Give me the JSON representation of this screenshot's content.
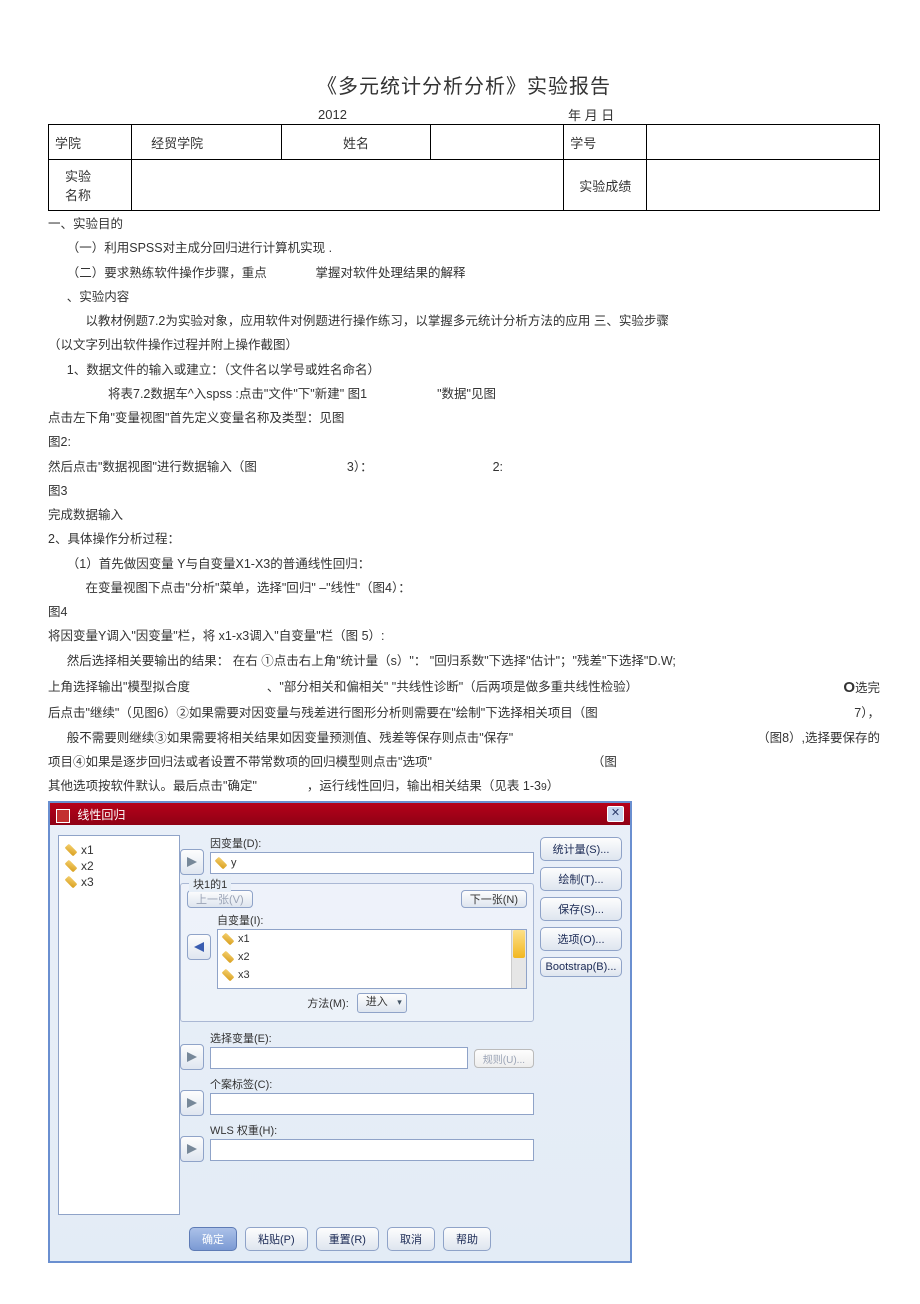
{
  "title": "《多元统计分析分析》实验报告",
  "date": {
    "year": "2012",
    "rest": "年 月 日"
  },
  "header": {
    "college_label": "学院",
    "college_value": "经贸学院",
    "name_label": "姓名",
    "id_label": "学号",
    "exp_name_label_1": "实验",
    "exp_name_label_2": "名称",
    "score_label": "实验成绩"
  },
  "body": {
    "sec1": "一、实验目的",
    "sec1_1": "（一）利用SPSS对主成分回归进行计算机实现 .",
    "sec1_2a": "（二）要求熟练软件操作步骤，重点",
    "sec1_2b": "掌握对软件处理结果的解释",
    "sec2": "、实验内容",
    "sec2_1": "以教材例题7.2为实验对象，应用软件对例题进行操作练习，以掌握多元统计分析方法的应用 三、实验步骤",
    "sec2_2": "（以文字列出软件操作过程并附上操作截图）",
    "step1": "1、数据文件的输入或建立：（文件名以学号或姓名命名）",
    "p1a": "将表7.2数据车^入spss :点击\"文件\"下\"新建\"  图1",
    "p1b": "\"数据\"见图",
    "p2": "点击左下角\"变量视图\"首先定义变量名称及类型：见图",
    "p3": "图2:",
    "p4a": "然后点击\"数据视图\"进行数据输入（图",
    "p4b": "3）：",
    "p4c": "2:",
    "p5": "图3",
    "p6": "完成数据输入",
    "step2": "2、具体操作分析过程：",
    "p7": "（1）首先做因变量 Y与自变量X1-X3的普通线性回归：",
    "p8": "在变量视图下点击\"分析\"菜单，选择\"回归\" –\"线性\"（图4）：",
    "p9": "图4",
    "p10": "将因变量Y调入\"因变量\"栏，将 x1-x3调入\"自变量\"栏（图 5）:",
    "p11a": "然后选择相关要输出的结果：  在右  ①点击右上角\"统计量（s）\"：  \"回归系数\"下选择\"估计\"；\"残差\"下选择\"D.W;",
    "p12a": "上角选择输出\"模型拟合度",
    "p12b": "、\"部分相关和偏相关\" \"共线性诊断\"（后两项是做多重共线性检验）",
    "p12c": "O",
    "p12d": "选完",
    "p13a": "后点击\"继续\"（见图6）②如果需要对因变量与残差进行图形分析则需要在\"绘制\"下选择相关项目（图",
    "p13b": "7），",
    "p14a": "般不需要则继续③如果需要将相关结果如因变量预测值、残差等保存则点击\"保存\"",
    "p14b": "（图8）,选择要保存的",
    "p15a": "项目④如果是逐步回归法或者设置不带常数项的回归模型则点击\"选项\"",
    "p15b": "（图",
    "p16a": "其他选项按软件默认。最后点击\"确定\"",
    "p16b": "，运行线性回归，输出相关结果（见表 1-3",
    "p16c": "9",
    "p16d": "）"
  },
  "dialog": {
    "title": "线性回归",
    "vars": [
      "x1",
      "x2",
      "x3"
    ],
    "dep_label": "因变量(D):",
    "dep_value": "y",
    "block_label": "块1的1",
    "prev_btn": "上一张(V)",
    "next_btn": "下一张(N)",
    "indep_label": "自变量(I):",
    "indep_values": [
      "x1",
      "x2",
      "x3"
    ],
    "method_label": "方法(M):",
    "method_value": "进入",
    "select_label": "选择变量(E):",
    "rule_btn": "规则(U)...",
    "case_label": "个案标签(C):",
    "wls_label": "WLS 权重(H):",
    "side": {
      "stats": "统计量(S)...",
      "plots": "绘制(T)...",
      "save": "保存(S)...",
      "options": "选项(O)...",
      "bootstrap": "Bootstrap(B)..."
    },
    "footer": {
      "ok": "确定",
      "paste": "粘贴(P)",
      "reset": "重置(R)",
      "cancel": "取消",
      "help": "帮助"
    }
  }
}
